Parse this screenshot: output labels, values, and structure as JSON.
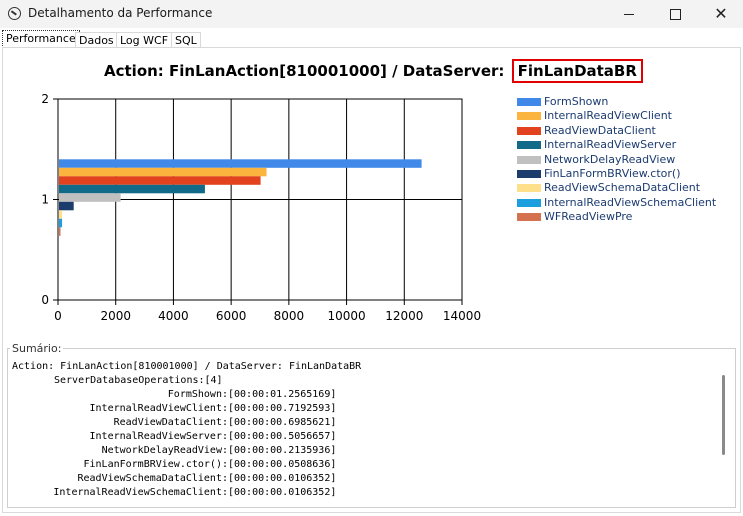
{
  "window": {
    "title": "Detalhamento da Performance"
  },
  "tabs": [
    {
      "label": "Performance",
      "active": true
    },
    {
      "label": "Dados"
    },
    {
      "label": "Log WCF"
    },
    {
      "label": "SQL"
    }
  ],
  "chart_title_prefix": "Action: FinLanAction[810001000] / DataServer:",
  "chart_title_highlight": "FinLanDataBR",
  "chart_data": {
    "type": "bar",
    "orientation": "horizontal",
    "title": "Action: FinLanAction[810001000] / DataServer: FinLanDataBR",
    "xlim": [
      0,
      14000
    ],
    "ylim": [
      0,
      2
    ],
    "xticks": [
      0,
      2000,
      4000,
      6000,
      8000,
      10000,
      12000,
      14000
    ],
    "yticks": [
      0,
      1,
      2
    ],
    "grid": true,
    "legend_position": "right",
    "series": [
      {
        "name": "FormShown",
        "value": 12565,
        "color": "#4189e8"
      },
      {
        "name": "InternalReadViewClient",
        "value": 7192,
        "color": "#fbb43e"
      },
      {
        "name": "ReadViewDataClient",
        "value": 6986,
        "color": "#e2431e"
      },
      {
        "name": "InternalReadViewServer",
        "value": 5057,
        "color": "#126a89"
      },
      {
        "name": "NetworkDelayReadView",
        "value": 2136,
        "color": "#c0c0c0"
      },
      {
        "name": "FinLanFormBRView.ctor()",
        "value": 509,
        "color": "#1c3c6e"
      },
      {
        "name": "ReadViewSchemaDataClient",
        "value": 106,
        "color": "#fee08b"
      },
      {
        "name": "InternalReadViewSchemaClient",
        "value": 106,
        "color": "#1c9fde"
      },
      {
        "name": "WFReadViewPre",
        "value": 50,
        "color": "#d4714e"
      }
    ]
  },
  "summary": {
    "label": "Sumário:",
    "header": "Action: FinLanAction[810001000] / DataServer: FinLanDataBR",
    "lines": [
      {
        "key": "ServerDatabaseOperations:",
        "value": "[4]",
        "indent": true
      },
      {
        "key": "FormShown:",
        "value": "[00:00:01.2565169]"
      },
      {
        "key": "InternalReadViewClient:",
        "value": "[00:00:00.7192593]"
      },
      {
        "key": "ReadViewDataClient:",
        "value": "[00:00:00.6985621]"
      },
      {
        "key": "InternalReadViewServer:",
        "value": "[00:00:00.5056657]"
      },
      {
        "key": "NetworkDelayReadView:",
        "value": "[00:00:00.2135936]"
      },
      {
        "key": "FinLanFormBRView.ctor():",
        "value": "[00:00:00.0508636]"
      },
      {
        "key": "ReadViewSchemaDataClient:",
        "value": "[00:00:00.0106352]"
      },
      {
        "key": "InternalReadViewSchemaClient:",
        "value": "[00:00:00.0106352]"
      }
    ]
  }
}
